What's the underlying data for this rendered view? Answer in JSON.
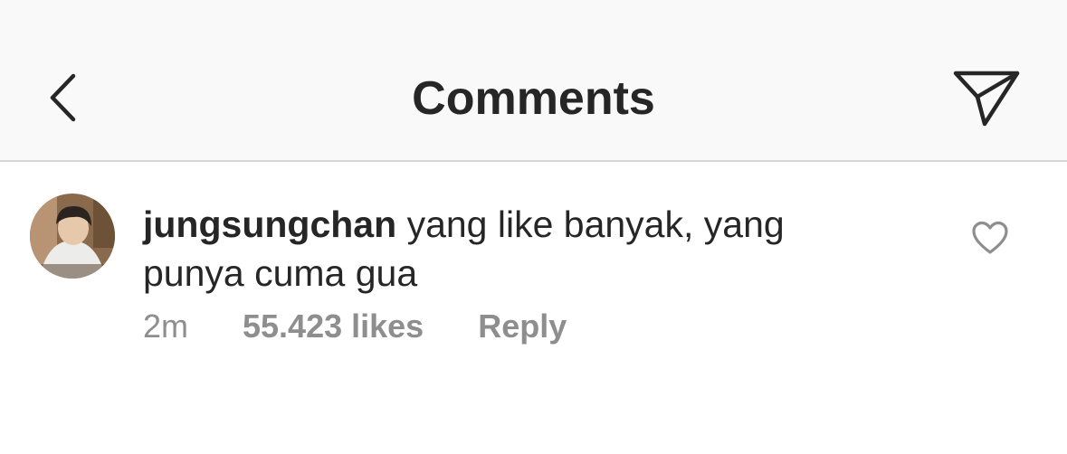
{
  "header": {
    "title": "Comments",
    "back_icon": "chevron-left-icon",
    "send_icon": "paper-plane-icon"
  },
  "comment": {
    "username": "jungsungchan",
    "text": "yang like banyak, yang punya cuma gua",
    "time": "2m",
    "likes": "55.423 likes",
    "reply_label": "Reply",
    "like_icon": "heart-outline-icon"
  },
  "colors": {
    "header_bg": "#f9f9f9",
    "text_primary": "#262626",
    "text_secondary": "#8e8e8e",
    "divider": "#d6d6d6"
  }
}
